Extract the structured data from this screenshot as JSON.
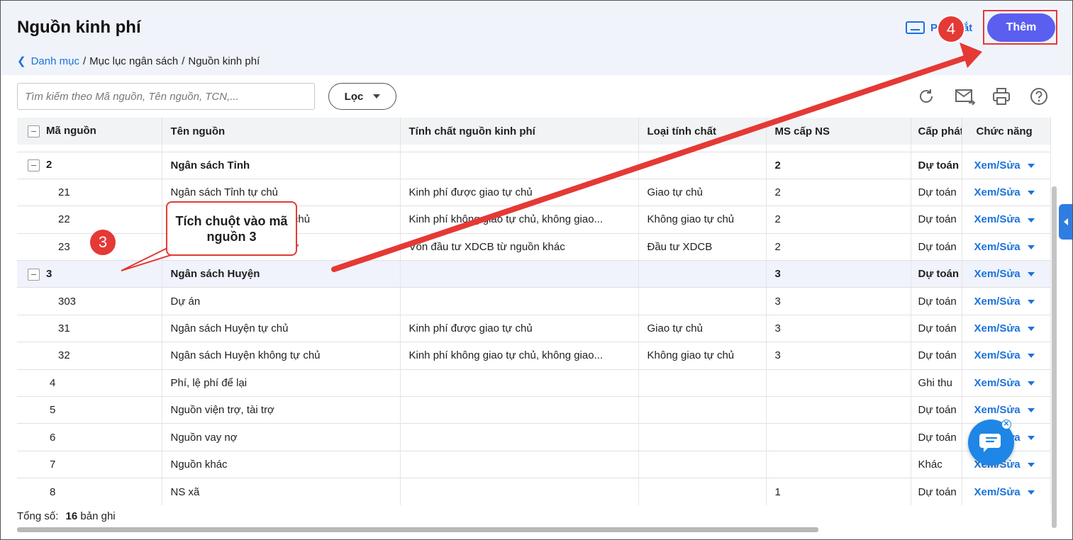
{
  "header": {
    "title": "Nguồn kinh phí",
    "breadcrumb": {
      "back_link": "Danh mục",
      "sep1": "/",
      "item2": "Mục lục ngân sách",
      "sep2": "/",
      "item3": "Nguồn kinh phí"
    },
    "shortcut_label": "Phím tắt",
    "add_button": "Thêm"
  },
  "toolbar": {
    "search_placeholder": "Tìm kiếm theo Mã nguồn, Tên nguồn, TCN,...",
    "filter_label": "Lọc",
    "icons": [
      "refresh-icon",
      "email-icon",
      "print-icon",
      "help-icon"
    ]
  },
  "table": {
    "columns": [
      "Mã nguồn",
      "Tên nguồn",
      "Tính chất nguồn kinh phí",
      "Loại tính chất",
      "MS cấp NS",
      "Cấp phát",
      "Chức năng"
    ],
    "action_label": "Xem/Sửa",
    "rows": [
      {
        "code": "2",
        "name": "Ngân sách Tỉnh",
        "nature": "",
        "type": "",
        "ms": "2",
        "cap": "Dự toán",
        "group": true
      },
      {
        "code": "21",
        "name": "Ngân sách Tỉnh tự chủ",
        "nature": "Kinh phí được giao tự chủ",
        "type": "Giao tự chủ",
        "ms": "2",
        "cap": "Dự toán"
      },
      {
        "code": "22",
        "name": "Ngân sách Tỉnh không tự chủ",
        "nature": "Kinh phí không giao tự chủ, không giao...",
        "type": "Không giao tự chủ",
        "ms": "2",
        "cap": "Dự toán"
      },
      {
        "code": "23",
        "name": "Ngân sách Tỉnh vốn đầu tư",
        "nature": "Vốn đầu tư XDCB từ nguồn khác",
        "type": "Đầu tư XDCB",
        "ms": "2",
        "cap": "Dự toán"
      },
      {
        "code": "3",
        "name": "Ngân sách Huyện",
        "nature": "",
        "type": "",
        "ms": "3",
        "cap": "Dự toán",
        "group": true,
        "highlight": true
      },
      {
        "code": "303",
        "name": "Dự án",
        "nature": "",
        "type": "",
        "ms": "3",
        "cap": "Dự toán"
      },
      {
        "code": "31",
        "name": "Ngân sách Huyện tự chủ",
        "nature": "Kinh phí được giao tự chủ",
        "type": "Giao tự chủ",
        "ms": "3",
        "cap": "Dự toán"
      },
      {
        "code": "32",
        "name": "Ngân sách Huyện không tự chủ",
        "nature": "Kinh phí không giao tự chủ, không giao...",
        "type": "Không giao tự chủ",
        "ms": "3",
        "cap": "Dự toán"
      },
      {
        "code": "4",
        "name": "Phí, lệ phí để lại",
        "nature": "",
        "type": "",
        "ms": "",
        "cap": "Ghi thu",
        "top": true
      },
      {
        "code": "5",
        "name": "Nguồn viện trợ, tài trợ",
        "nature": "",
        "type": "",
        "ms": "",
        "cap": "Dự toán",
        "top": true
      },
      {
        "code": "6",
        "name": "Nguồn vay nợ",
        "nature": "",
        "type": "",
        "ms": "",
        "cap": "Dự toán",
        "top": true
      },
      {
        "code": "7",
        "name": "Nguồn khác",
        "nature": "",
        "type": "",
        "ms": "",
        "cap": "Khác",
        "top": true
      },
      {
        "code": "8",
        "name": "NS xã",
        "nature": "",
        "type": "",
        "ms": "1",
        "cap": "Dự toán",
        "top": true
      }
    ]
  },
  "footer": {
    "total_label": "Tổng số:",
    "total_count": "16",
    "total_unit": "bản ghi"
  },
  "annotations": {
    "callout_text": "Tích chuột vào mã nguồn 3",
    "badge3": "3",
    "badge4": "4",
    "accent_color": "#e53935"
  }
}
